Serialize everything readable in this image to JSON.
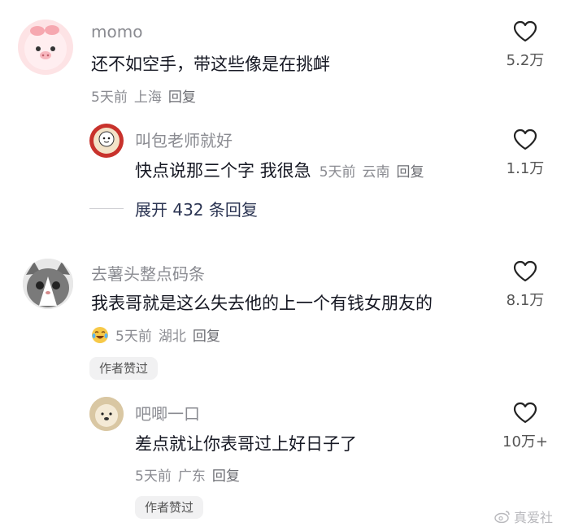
{
  "comments": [
    {
      "user": "momo",
      "text": "还不如空手，带这些像是在挑衅",
      "time": "5天前",
      "location": "上海",
      "reply": "回复",
      "likes": "5.2万",
      "replies": [
        {
          "user": "叫包老师就好",
          "text": "快点说那三个字 我很急",
          "time": "5天前",
          "location": "云南",
          "reply": "回复",
          "likes": "1.1万"
        }
      ],
      "expand_label": "展开 432 条回复"
    },
    {
      "user": "去薯头整点码条",
      "text": "我表哥就是这么失去他的上一个有钱女朋友的",
      "time": "5天前",
      "location": "湖北",
      "reply": "回复",
      "likes": "8.1万",
      "author_liked": "作者赞过",
      "replies": [
        {
          "user": "吧唧一口",
          "text": "差点就让你表哥过上好日子了",
          "time": "5天前",
          "location": "广东",
          "reply": "回复",
          "likes": "10万+",
          "author_liked": "作者赞过"
        }
      ]
    }
  ],
  "watermark": "真爱社",
  "icons": {
    "like": "heart-outline-icon",
    "emoji": "crying-laugh-emoji-icon",
    "watermark": "weibo-icon"
  }
}
